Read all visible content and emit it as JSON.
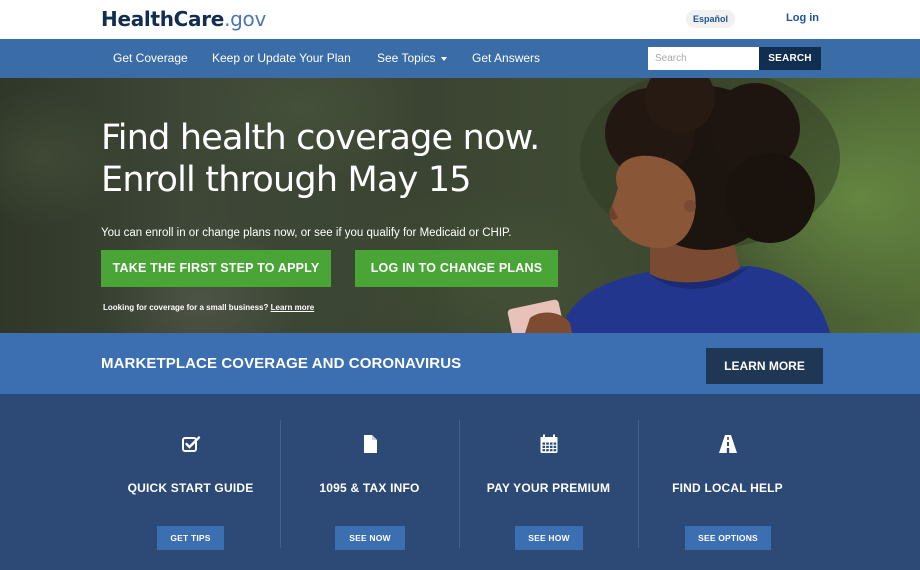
{
  "header": {
    "logo_brand": "HealthCare",
    "logo_tld": ".gov",
    "espanol_label": "Español",
    "login_label": "Log in"
  },
  "nav": {
    "items": [
      {
        "label": "Get Coverage"
      },
      {
        "label": "Keep or Update Your Plan"
      },
      {
        "label": "See Topics"
      },
      {
        "label": "Get Answers"
      }
    ],
    "search_placeholder": "Search",
    "search_button": "SEARCH"
  },
  "hero": {
    "title_line1": "Find health coverage now.",
    "title_line2": "Enroll through May 15",
    "subtitle": "You can enroll in or change plans now, or see if you qualify for Medicaid or CHIP.",
    "apply_button": "TAKE THE FIRST STEP TO APPLY",
    "login_button": "LOG IN TO CHANGE PLANS",
    "small_business_text": "Looking for coverage for a small business?",
    "small_business_link": "Learn more"
  },
  "banner": {
    "title": "MARKETPLACE COVERAGE AND CORONAVIRUS",
    "button": "LEARN MORE"
  },
  "tiles": [
    {
      "title": "QUICK START GUIDE",
      "button": "GET TIPS",
      "icon": "checkbox-icon"
    },
    {
      "title": "1095 & TAX INFO",
      "button": "SEE NOW",
      "icon": "document-icon"
    },
    {
      "title": "PAY YOUR PREMIUM",
      "button": "SEE HOW",
      "icon": "calendar-icon"
    },
    {
      "title": "FIND LOCAL HELP",
      "button": "SEE OPTIONS",
      "icon": "road-icon"
    }
  ],
  "colors": {
    "nav": "#3a6ca8",
    "green": "#4aa537",
    "banner": "#3b6fb2",
    "tiles_bg": "#2c4a75",
    "dark": "#112e51"
  }
}
